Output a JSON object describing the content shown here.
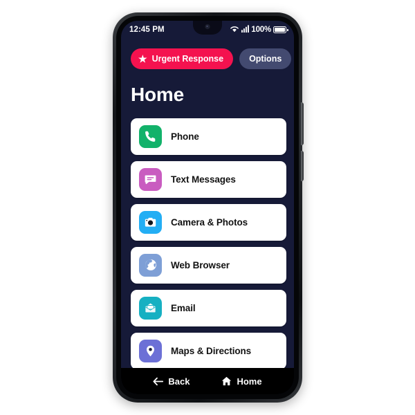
{
  "device": {
    "frame_color": "#212429",
    "screen_bg": "#161a38"
  },
  "status_bar": {
    "time": "12:45 PM",
    "wifi_icon": "wifi-icon",
    "signal_icon": "cellular-signal-icon",
    "battery_percent": "100%",
    "battery_icon": "battery-full-icon",
    "camera_icon": "front-camera-icon"
  },
  "top_actions": {
    "urgent": {
      "label": "Urgent Response",
      "icon": "star-icon",
      "color": "#f4124f"
    },
    "options": {
      "label": "Options",
      "color": "#434a70"
    }
  },
  "page": {
    "title": "Home"
  },
  "menu": {
    "items": [
      {
        "label": "Phone",
        "icon": "phone-handset-icon",
        "icon_bg": "#12b26a"
      },
      {
        "label": "Text Messages",
        "icon": "chat-bubble-icon",
        "icon_bg": "#c95cc0"
      },
      {
        "label": "Camera & Photos",
        "icon": "camera-icon",
        "icon_bg": "#23aef4"
      },
      {
        "label": "Web Browser",
        "icon": "globe-icon",
        "icon_bg": "#7e9fd6"
      },
      {
        "label": "Email",
        "icon": "envelope-icon",
        "icon_bg": "#16b0c2"
      },
      {
        "label": "Maps & Directions",
        "icon": "map-pin-icon",
        "icon_bg": "#6c70d6"
      }
    ]
  },
  "bottom_nav": {
    "back": {
      "label": "Back",
      "icon": "arrow-left-icon"
    },
    "home": {
      "label": "Home",
      "icon": "house-icon"
    }
  }
}
